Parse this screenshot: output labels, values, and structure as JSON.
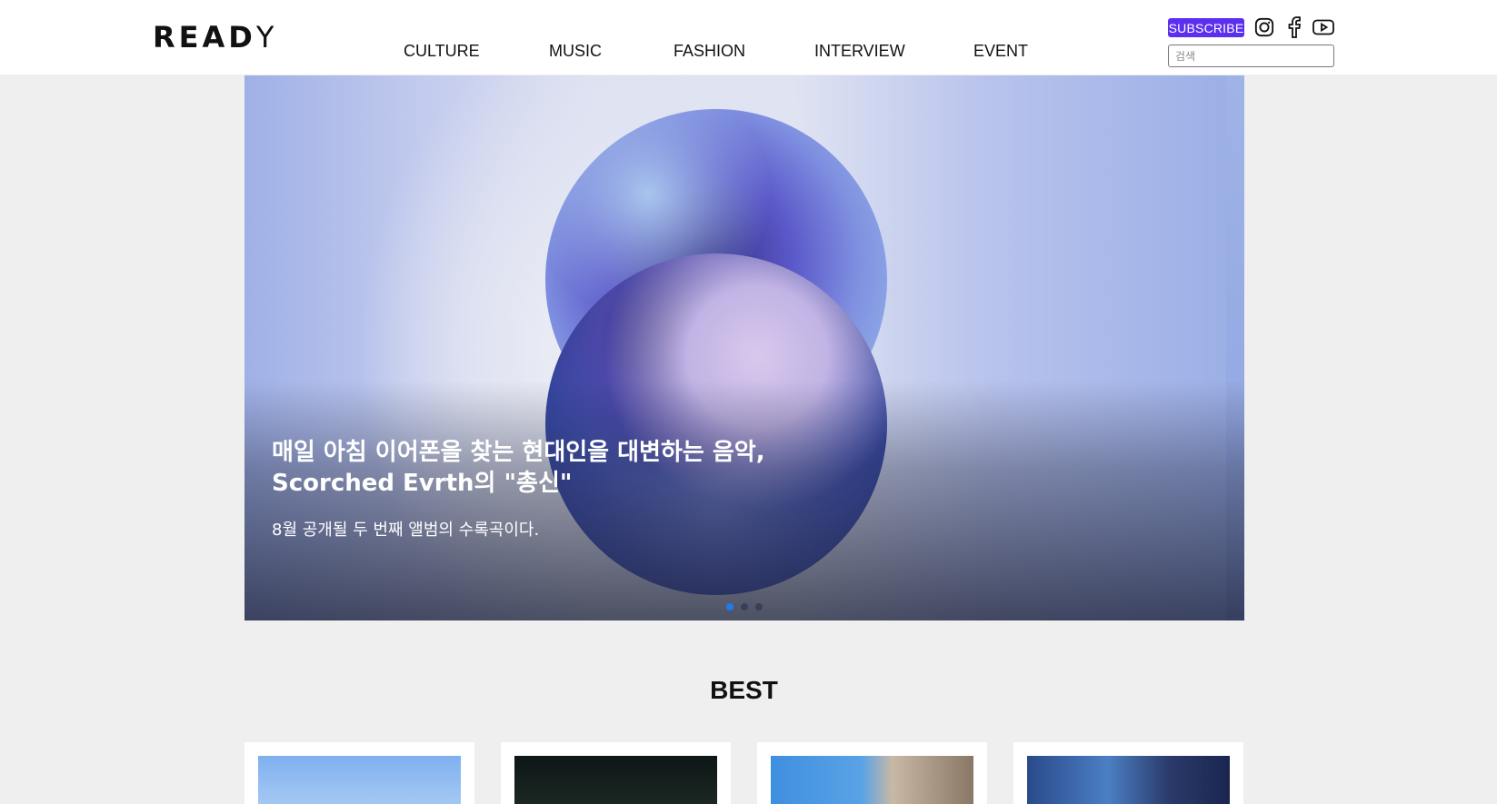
{
  "header": {
    "logo_bold": "READ",
    "logo_thin": "Y",
    "nav": [
      "CULTURE",
      "MUSIC",
      "FASHION",
      "INTERVIEW",
      "EVENT"
    ],
    "subscribe_label": "SUBSCRIBE",
    "social_icons": [
      "instagram-icon",
      "facebook-icon",
      "youtube-icon"
    ],
    "search_placeholder": "검색"
  },
  "hero": {
    "title_line1": "매일 아침 이어폰을 찾는 현대인을 대변하는 음악,",
    "title_line2": "Scorched Evrth의 \"총신\"",
    "subtitle": "8월 공개될 두 번째 앨범의 수록곡이다.",
    "slides_total": 3,
    "active_slide": 1
  },
  "best": {
    "title": "BEST"
  },
  "colors": {
    "subscribe_bg": "#5b2ff0",
    "active_dot": "#1d7cf2",
    "header_bg": "#ffffff",
    "page_bg": "#efefef"
  }
}
